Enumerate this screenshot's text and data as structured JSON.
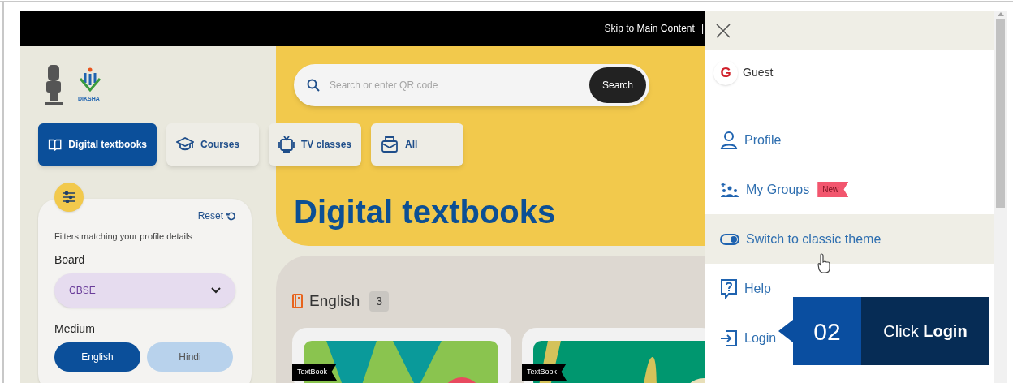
{
  "top_bar": {
    "skip_link": "Skip to Main Content",
    "separator": "|"
  },
  "logo": {
    "text": "DIKSHA"
  },
  "search": {
    "placeholder": "Search or enter QR code",
    "button": "Search"
  },
  "nav_tabs": [
    {
      "kind": "book",
      "label": "Digital textbooks",
      "selected": true
    },
    {
      "kind": "cap",
      "label": "Courses",
      "selected": false
    },
    {
      "kind": "tv",
      "label": "TV classes",
      "selected": false
    },
    {
      "kind": "tray",
      "label": "All",
      "selected": false
    }
  ],
  "filters": {
    "reset": "Reset",
    "note": "Filters matching your profile details",
    "board": {
      "label": "Board",
      "value": "CBSE"
    },
    "medium": {
      "label": "Medium",
      "options": [
        {
          "label": "English",
          "selected": true
        },
        {
          "label": "Hindi",
          "selected": false
        }
      ]
    }
  },
  "banner": {
    "title": "Digital textbooks"
  },
  "section": {
    "title": "English",
    "count": "3",
    "cards": [
      {
        "kind": "green",
        "badge": "TextBook"
      },
      {
        "kind": "teal",
        "badge": "TextBook"
      }
    ]
  },
  "menu": {
    "user": {
      "initial": "G",
      "name": "Guest"
    },
    "items": [
      {
        "kind": "profile",
        "label": "Profile",
        "highlighted": false
      },
      {
        "kind": "groups",
        "label": "My Groups",
        "badge": "New",
        "highlighted": false
      },
      {
        "kind": "toggle",
        "label": "Switch to classic theme",
        "highlighted": true
      },
      {
        "kind": "help",
        "label": "Help",
        "highlighted": false
      },
      {
        "kind": "login",
        "label": "Login",
        "highlighted": false
      }
    ]
  },
  "callout": {
    "step": "02",
    "text": "Click **Login**"
  }
}
